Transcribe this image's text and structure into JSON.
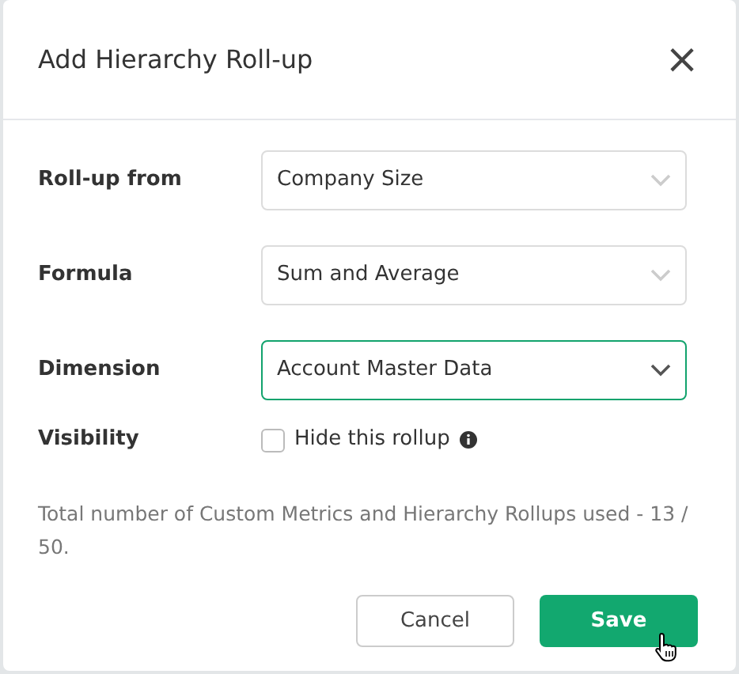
{
  "dialog": {
    "title": "Add Hierarchy Roll-up",
    "close": "×"
  },
  "fields": [
    {
      "kind": "select",
      "label": "Roll-up from",
      "value": "Company Size",
      "focused": false
    },
    {
      "kind": "select",
      "label": "Formula",
      "value": "Sum and Average",
      "focused": false
    },
    {
      "kind": "select",
      "label": "Dimension",
      "value": "Account Master Data",
      "focused": true
    },
    {
      "kind": "checkbox",
      "label": "Visibility",
      "text": "Hide this rollup",
      "checked": false
    }
  ],
  "note": "Total number of Custom Metrics and Hierarchy Rollups used - 13 / 50.",
  "buttons": [
    {
      "label": "Cancel",
      "kind": "secondary"
    },
    {
      "label": "Save",
      "kind": "primary"
    }
  ]
}
